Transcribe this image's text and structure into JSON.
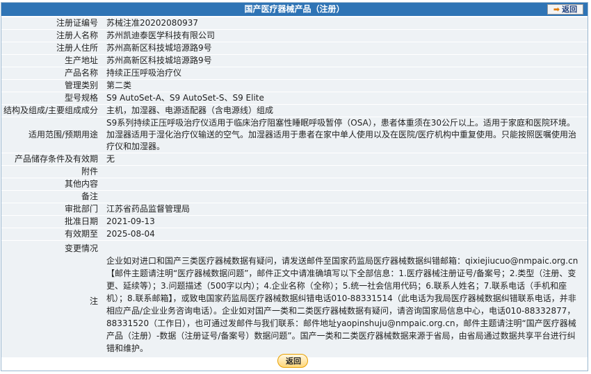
{
  "header": {
    "title": "国产医疗器械产品（注册）",
    "back_label": "返回"
  },
  "fields": [
    {
      "label": "注册证编号",
      "value": "苏械注准20202080937"
    },
    {
      "label": "注册人名称",
      "value": "苏州凯迪泰医学科技有限公司"
    },
    {
      "label": "注册人住所",
      "value": "苏州高新区科技城培源路9号"
    },
    {
      "label": "生产地址",
      "value": "苏州高新区科技城培源路9号"
    },
    {
      "label": "产品名称",
      "value": "持续正压呼吸治疗仪"
    },
    {
      "label": "管理类别",
      "value": "第二类"
    },
    {
      "label": "型号规格",
      "value": "S9 AutoSet-A、S9 AutoSet-S、S9 Elite"
    },
    {
      "label": "结构及组成/主要组成成分",
      "value": "主机，加湿器、电源适配器（含电源线）组成"
    },
    {
      "label": "适用范围/预期用途",
      "value": "S9系列持续正压呼吸治疗仪适用于临床治疗阻塞性睡眠呼吸暂停（OSA），患者体重须在30公斤以上。适用于家庭和医院环境。加湿器适用于湿化治疗仪输送的空气。加湿器适用于患者在家中单人使用以及在医院/医疗机构中重复使用。只能按照医嘱使用治疗仪和加湿器。"
    },
    {
      "label": "产品储存条件及有效期",
      "value": "无"
    },
    {
      "label": "附件",
      "value": ""
    },
    {
      "label": "其他内容",
      "value": ""
    },
    {
      "label": "备注",
      "value": ""
    },
    {
      "label": "审批部门",
      "value": "江苏省药品监督管理局"
    },
    {
      "label": "批准日期",
      "value": "2021-09-13"
    },
    {
      "label": "有效期至",
      "value": "2025-08-04"
    }
  ],
  "changes_label": "变更情况",
  "note_label": "注",
  "note_text": "企业如对进口和国产三类医疗器械数据有疑问，请发送邮件至国家药监局医疗器械数据纠错邮箱：qixiejiucuo@nmpaic.org.cn【邮件主题请注明“医疗器械数据问题”，邮件正文中请准确填写以下全部信息：1.医疗器械注册证号/备案号；2.类型（注册、变更、延续等）；3.问题描述（500字以内）；4.企业名称（全称）；5.统一社会信用代码；6.联系人姓名；7.联系电话（手机和座机）；8.联系邮箱】，或致电国家药监局医疗器械数据纠错电话010-88331514（此电话为我局医疗器械数据纠错联系电话，并非相应产品/企业业务咨询电话）。企业如对国产一类和二类医疗器械数据有疑问，请咨询国家局信息中心，电话010-88332877，88331520（工作日），也可通过发邮件与我们联系：邮件地址yaopinshuju@nmpaic.org.cn，邮件主题请注明“国产医疗器械产品（注册）-数据（注册证号/备案号）数据问题”。国产一类和二类医疗器械数据来源于省局，由省局通过数据共享平台进行纠错和维护。",
  "footer": {
    "back_label": "返回"
  }
}
